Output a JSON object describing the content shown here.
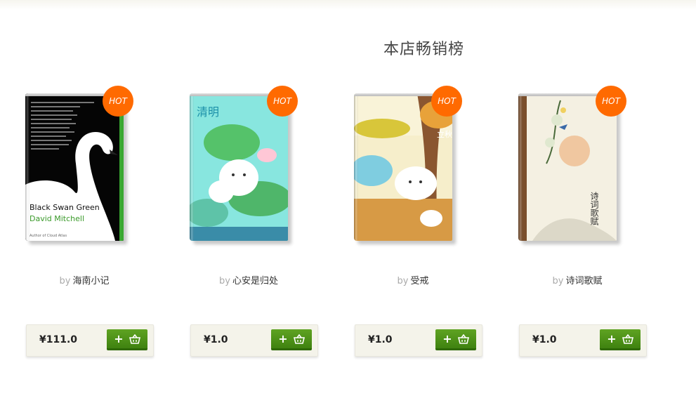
{
  "section": {
    "title": "本店畅销榜"
  },
  "hot_label": "HOT",
  "by_label": "by",
  "books": [
    {
      "author": "海南小记",
      "price": "¥111.0",
      "cover": {
        "title": "Black Swan Green",
        "author": "David Mitchell",
        "note": "Author of Cloud Atlas"
      }
    },
    {
      "author": "心安是归处",
      "price": "¥1.0",
      "cover": {
        "title": "清明"
      }
    },
    {
      "author": "受戒",
      "price": "¥1.0",
      "cover": {
        "title": "立秋"
      }
    },
    {
      "author": "诗词歌赋",
      "price": "¥1.0",
      "cover": {
        "title": "诗词歌赋"
      }
    }
  ],
  "icons": {
    "add": "plus-icon",
    "cart": "basket-icon"
  },
  "colors": {
    "hot": "#ff6a00",
    "button": "#4a8f17"
  }
}
